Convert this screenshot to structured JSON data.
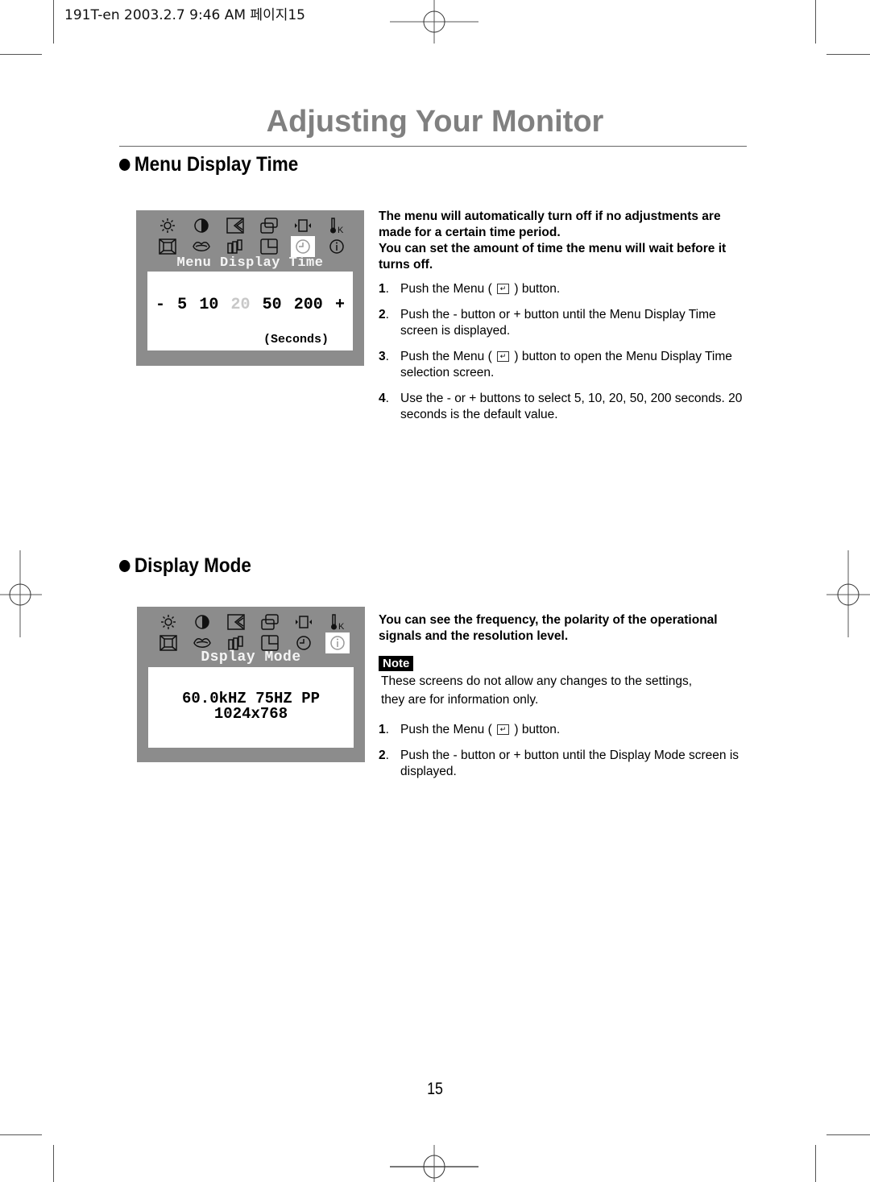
{
  "header": {
    "slug": "191T-en  2003.2.7 9:46 AM 페이지15"
  },
  "page": {
    "title": "Adjusting Your Monitor",
    "number": "15"
  },
  "sections": [
    {
      "heading": "Menu Display Time",
      "osd": {
        "title": "Menu Display Time",
        "selected_icon": "clock-icon",
        "options": [
          {
            "label": "-",
            "active": true
          },
          {
            "label": "5",
            "active": true
          },
          {
            "label": "10",
            "active": true
          },
          {
            "label": "20",
            "active": false
          },
          {
            "label": "50",
            "active": true
          },
          {
            "label": "200",
            "active": true
          },
          {
            "label": "+",
            "active": true
          }
        ],
        "unit": "(Seconds)"
      },
      "intro": [
        "The menu will automatically turn off if no adjustments are made for a certain time period.",
        "You can set the amount of time the menu will wait before it turns off."
      ],
      "steps": [
        {
          "num": "1",
          "pre": "Push the Menu (",
          "post": ") button.",
          "has_key": true
        },
        {
          "num": "2",
          "text": "Push the - button or + button until the Menu Display Time screen is displayed.",
          "has_key": false
        },
        {
          "num": "3",
          "pre": "Push the Menu (",
          "post": ") button to open the Menu Display Time selection screen.",
          "has_key": true
        },
        {
          "num": "4",
          "text": "Use the - or + buttons to select 5, 10, 20, 50, 200 seconds. 20 seconds is the default value.",
          "has_key": false
        }
      ]
    },
    {
      "heading": "Display Mode",
      "osd": {
        "title": "Dsplay Mode",
        "selected_icon": "info-icon",
        "line1": "60.0kHZ 75HZ PP",
        "line2": "1024x768"
      },
      "intro": [
        "You can see the frequency, the polarity of the operational signals and the resolution level."
      ],
      "note": {
        "badge": "Note",
        "text": "These screens do not allow any changes to the settings, they are for information only."
      },
      "steps": [
        {
          "num": "1",
          "pre": "Push the Menu (",
          "post": ") button.",
          "has_key": true
        },
        {
          "num": "2",
          "text": "Push the - button or + button until the Display Mode screen is displayed.",
          "has_key": false
        }
      ]
    }
  ],
  "icons": {
    "menu_key_glyph": "↵",
    "osd_icon_rows": [
      [
        "brightness-icon",
        "contrast-icon",
        "geometry-icon",
        "position-icon",
        "size-icon",
        "color-temp-icon"
      ],
      [
        "pincushion-icon",
        "moire-icon",
        "balance-icon",
        "zoom-icon",
        "clock-icon",
        "info-icon"
      ]
    ]
  },
  "colors": {
    "title_gray": "#808080",
    "osd_frame": "#8c8c8c",
    "osd_disabled": "#c8c8c8"
  }
}
